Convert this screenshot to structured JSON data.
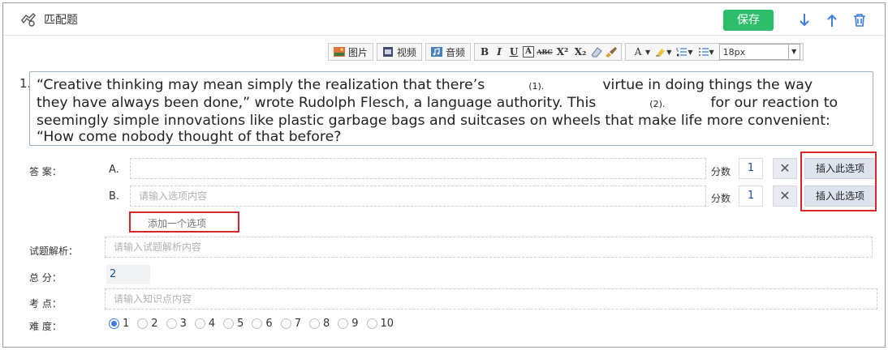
{
  "header": {
    "title": "匹配题",
    "save_label": "保存",
    "actions": [
      "download-arrow-icon",
      "upload-arrow-icon",
      "delete-icon"
    ]
  },
  "toolbar": {
    "image_label": "图片",
    "video_label": "视频",
    "audio_label": "音频",
    "format_buttons": [
      "B",
      "I",
      "U",
      "A",
      "ABC",
      "X²",
      "X₂"
    ],
    "font_size": "18px"
  },
  "question": {
    "number": "1.",
    "lines": [
      "“Creative thinking may mean simply the realization that there’s",
      "they have always been done,”  wrote Rudolph Flesch, a language authority. This",
      "seemingly simple innovations like plastic garbage bags and suitcases on wheels that make life more convenient:",
      "“How come nobody thought of that before?"
    ],
    "line1_after": "virtue in doing things the way",
    "line2_after": "for our reaction to",
    "blank1": "(1).",
    "blank2": "(2)."
  },
  "answer": {
    "label": "答    案：",
    "options": [
      {
        "letter": "A.",
        "placeholder": "",
        "score_label": "分数",
        "score": "1",
        "insert_label": "插入此选项"
      },
      {
        "letter": "B.",
        "placeholder": "请输入选项内容",
        "score_label": "分数",
        "score": "1",
        "insert_label": "插入此选项"
      }
    ],
    "add_option_label": "添加一个选项"
  },
  "analysis": {
    "label": "试题解析：",
    "placeholder": "请输入试题解析内容"
  },
  "total": {
    "label": "总    分：",
    "value": "2"
  },
  "knowledge": {
    "label": "考    点：",
    "placeholder": "请输入知识点内容"
  },
  "difficulty": {
    "label": "难    度：",
    "options": [
      "1",
      "2",
      "3",
      "4",
      "5",
      "6",
      "7",
      "8",
      "9",
      "10"
    ],
    "selected": "1"
  },
  "colors": {
    "accent": "#3b7ddd",
    "save": "#2ebd6b",
    "highlight_box": "#d9232a"
  }
}
